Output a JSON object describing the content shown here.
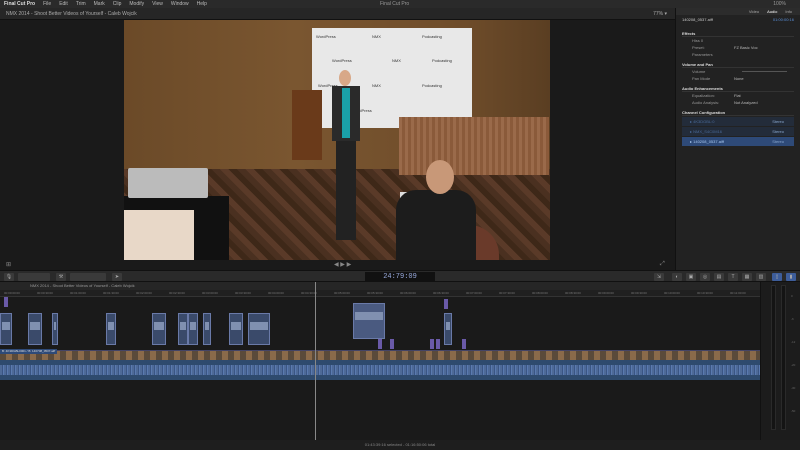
{
  "menubar": {
    "app": "Final Cut Pro",
    "items": [
      "File",
      "Edit",
      "Trim",
      "Mark",
      "Clip",
      "Modify",
      "View",
      "Window",
      "Help"
    ],
    "window_title": "Final Cut Pro",
    "status": "100%"
  },
  "viewer": {
    "title": "NMX 2014 - Shoot Better Videos of Yourself - Caleb Wojcik",
    "zoom": "77% ▾",
    "logos": [
      "WordPress",
      "NMX",
      "Podcasting",
      "WordPress",
      "NMX",
      "Podcasting",
      "WordPress",
      "NMX",
      "Podcasting",
      "WordPress"
    ]
  },
  "inspector": {
    "tabs": [
      "Video",
      "Audio",
      "Info"
    ],
    "clip_name": "140208_0537.aiff",
    "clip_tc": "01:00:00:16",
    "effects_header": "Effects",
    "effect_name": "Hiss 0",
    "effect_rows": [
      {
        "label": "Preset:",
        "value": "FZ Basic Voc"
      },
      {
        "label": "Parameters",
        "value": ""
      }
    ],
    "volume_header": "Volume and Pan",
    "volume_rows": [
      {
        "label": "Volume",
        "value": "0"
      },
      {
        "label": "Pan Mode",
        "value": "None"
      }
    ],
    "enh_header": "Audio Enhancements",
    "enh_rows": [
      {
        "label": "Equalization:",
        "value": "Flat"
      },
      {
        "label": "Audio Analysis:",
        "value": "Not Analyzed"
      }
    ],
    "channel_header": "Channel Configuration",
    "channels": [
      {
        "name": "▸ 4K3DGBL:0",
        "state": "Stereo"
      },
      {
        "name": "▸ NMX_S4C0M16",
        "state": "Stereo"
      },
      {
        "name": "▸ 140208_0537.aiff",
        "state": "Stereo"
      }
    ]
  },
  "toolbar": {
    "timecode": "24:79:09"
  },
  "timeline": {
    "project": "NMX 2014 - Shoot Better Videos of Yourself - Caleb Wojcik",
    "primary_label": "B: 4K3DGBL0001 / B: 140708_0537.aiff",
    "ruler": [
      "00:00:00:00",
      "00:00:30:00",
      "00:01:00:00",
      "00:01:30:00",
      "00:02:00:00",
      "00:02:30:00",
      "00:03:00:00",
      "00:03:30:00",
      "00:04:00:00",
      "00:04:30:00",
      "00:05:00:00",
      "00:05:30:00",
      "00:06:00:00",
      "00:06:30:00",
      "00:07:00:00",
      "00:07:30:00",
      "00:08:00:00",
      "00:08:30:00",
      "00:09:00:00",
      "00:09:30:00",
      "00:10:00:00",
      "00:10:30:00",
      "00:11:00:00"
    ],
    "meter_scale": [
      "0",
      "-6",
      "-12",
      "-20",
      "-30",
      "-50"
    ]
  },
  "footer": {
    "status": "01:43:39:16 selected - 01:16:50:06 total"
  }
}
